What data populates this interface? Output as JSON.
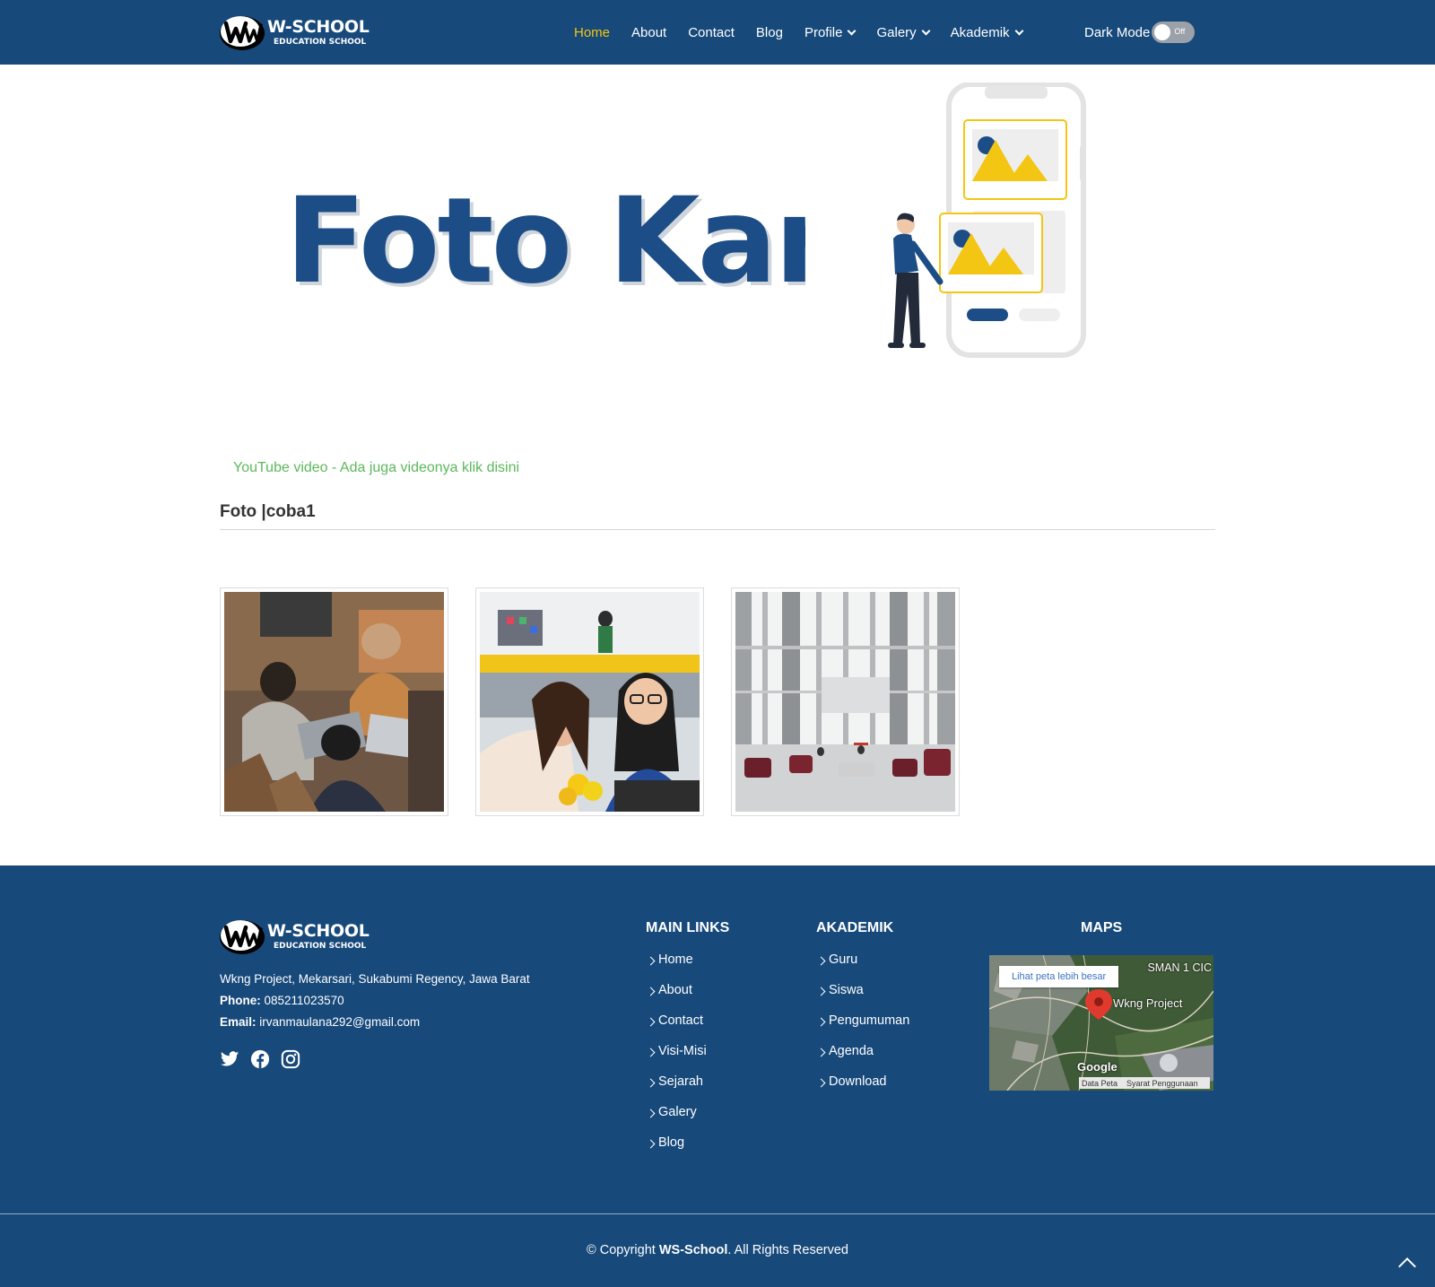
{
  "header": {
    "logo_title": "W-SCHOOL",
    "logo_sub": "EDUCATION SCHOOL",
    "nav": [
      {
        "label": "Home",
        "active": true,
        "dropdown": false
      },
      {
        "label": "About",
        "active": false,
        "dropdown": false
      },
      {
        "label": "Contact",
        "active": false,
        "dropdown": false
      },
      {
        "label": "Blog",
        "active": false,
        "dropdown": false
      },
      {
        "label": "Profile",
        "active": false,
        "dropdown": true
      },
      {
        "label": "Galery",
        "active": false,
        "dropdown": true
      },
      {
        "label": "Akademik",
        "active": false,
        "dropdown": true
      }
    ],
    "dark_mode_label": "Dark Mode",
    "toggle_state": "Off"
  },
  "hero": {
    "title": "Foto Kami",
    "illustration": "phone-gallery-illustration"
  },
  "main": {
    "video_link": "YouTube video - Ada juga videonya klik disini",
    "section_title": "Foto |coba1",
    "photos": [
      {
        "name": "students-laptops-photo"
      },
      {
        "name": "women-office-photo"
      },
      {
        "name": "campus-hall-photo"
      }
    ]
  },
  "footer": {
    "logo_title": "W-SCHOOL",
    "logo_sub": "EDUCATION SCHOOL",
    "address": "Wkng Project, Mekarsari, Sukabumi Regency, Jawa Barat",
    "phone_label": "Phone:",
    "phone": "085211023570",
    "email_label": "Email:",
    "email": "irvanmaulana292@gmail.com",
    "socials": [
      "twitter-icon",
      "facebook-icon",
      "instagram-icon"
    ],
    "main_links_title": "MAIN LINKS",
    "main_links": [
      "Home",
      "About",
      "Contact",
      "Visi-Misi",
      "Sejarah",
      "Galery",
      "Blog"
    ],
    "akademik_title": "AKADEMIK",
    "akademik_links": [
      "Guru",
      "Siswa",
      "Pengumuman",
      "Agenda",
      "Download"
    ],
    "maps_title": "MAPS",
    "map": {
      "title": "SMAN 1 CIC",
      "link": "Lihat peta lebih besar",
      "pin_label": "Wkng Project",
      "google": "Google",
      "data": "Data Peta",
      "terms": "Syarat Penggunaan"
    },
    "copyright_prefix": "© Copyright",
    "copyright_brand": "WS-School",
    "copyright_suffix": ". All Rights Reserved"
  },
  "colors": {
    "primary": "#17497b",
    "active_nav": "#f2c612",
    "link_green": "#5cb85c",
    "accent_yellow": "#f2c612"
  }
}
